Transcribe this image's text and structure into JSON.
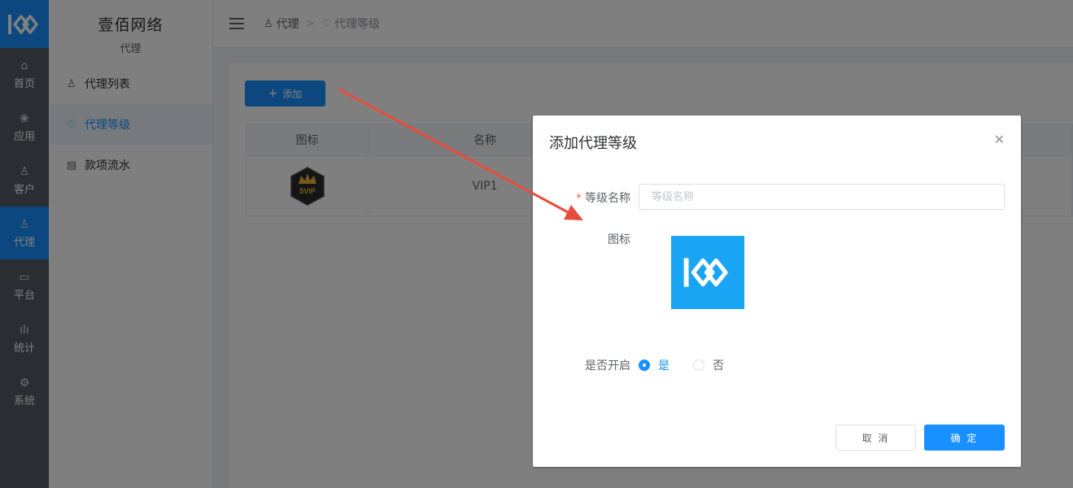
{
  "rail": {
    "items": [
      {
        "label": "首页",
        "icon": "home-icon"
      },
      {
        "label": "应用",
        "icon": "apps-icon"
      },
      {
        "label": "客户",
        "icon": "user-icon"
      },
      {
        "label": "代理",
        "icon": "agent-icon"
      },
      {
        "label": "平台",
        "icon": "monitor-icon"
      },
      {
        "label": "统计",
        "icon": "chart-icon"
      },
      {
        "label": "系统",
        "icon": "gear-icon"
      }
    ],
    "active_index": 3
  },
  "sidebar": {
    "brand": "壹佰网络",
    "section": "代理",
    "items": [
      {
        "label": "代理列表",
        "icon": "user-icon"
      },
      {
        "label": "代理等级",
        "icon": "heart-icon"
      },
      {
        "label": "款项流水",
        "icon": "list-icon"
      }
    ],
    "active_index": 1
  },
  "header": {
    "breadcrumb": [
      "代理",
      "代理等级"
    ],
    "separator": ">"
  },
  "toolbar": {
    "add_label": "添加"
  },
  "table": {
    "headers": [
      "图标",
      "名称"
    ],
    "rows": [
      {
        "icon_text": "5VIP",
        "name": "VIP1"
      }
    ]
  },
  "dialog": {
    "title": "添加代理等级",
    "level_name_label": "等级名称",
    "level_name_placeholder": "等级名称",
    "level_name_value": "",
    "icon_label": "图标",
    "enable_label": "是否开启",
    "option_yes": "是",
    "option_no": "否",
    "selected": "是",
    "cancel_label": "取 消",
    "confirm_label": "确 定"
  },
  "colors": {
    "accent": "#1890ff",
    "rail_bg": "#545c64",
    "icon_box": "#1aa5f4",
    "arrow": "#e74c3c"
  }
}
